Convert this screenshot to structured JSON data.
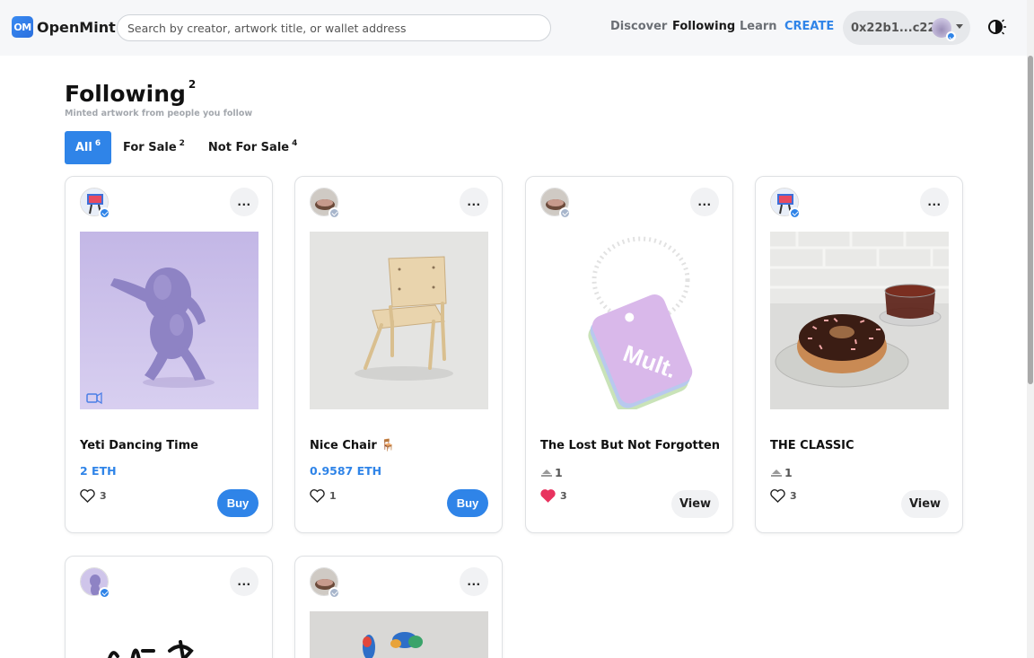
{
  "header": {
    "logo_mark": "OM",
    "logo_text": "OpenMint",
    "search_placeholder": "Search by creator, artwork title, or wallet address",
    "nav": {
      "discover": "Discover",
      "following": "Following",
      "learn": "Learn",
      "create": "CREATE"
    },
    "wallet_address": "0x22b1...c22"
  },
  "page": {
    "title": "Following",
    "title_count": "2",
    "subtitle": "Minted artwork from people you follow",
    "tabs": [
      {
        "label": "All",
        "count": "6",
        "active": true
      },
      {
        "label": "For Sale",
        "count": "2",
        "active": false
      },
      {
        "label": "Not For Sale",
        "count": "4",
        "active": false
      }
    ]
  },
  "cards": [
    {
      "title": "Yeti Dancing Time",
      "price": "2 ETH",
      "likes": "3",
      "liked": false,
      "action": "Buy",
      "more": "..."
    },
    {
      "title": "Nice Chair 🪑",
      "price": "0.9587 ETH",
      "likes": "1",
      "liked": false,
      "action": "Buy",
      "more": "..."
    },
    {
      "title": "The Lost But Not Forgotten",
      "editions": "1",
      "likes": "3",
      "liked": true,
      "action": "View",
      "more": "...",
      "art_text": "Mult."
    },
    {
      "title": "THE CLASSIC",
      "editions": "1",
      "likes": "3",
      "liked": false,
      "action": "View",
      "more": "..."
    },
    {
      "more": "..."
    },
    {
      "more": "..."
    }
  ],
  "colors": {
    "accent": "#2f84e8",
    "liked": "#e8335f"
  }
}
